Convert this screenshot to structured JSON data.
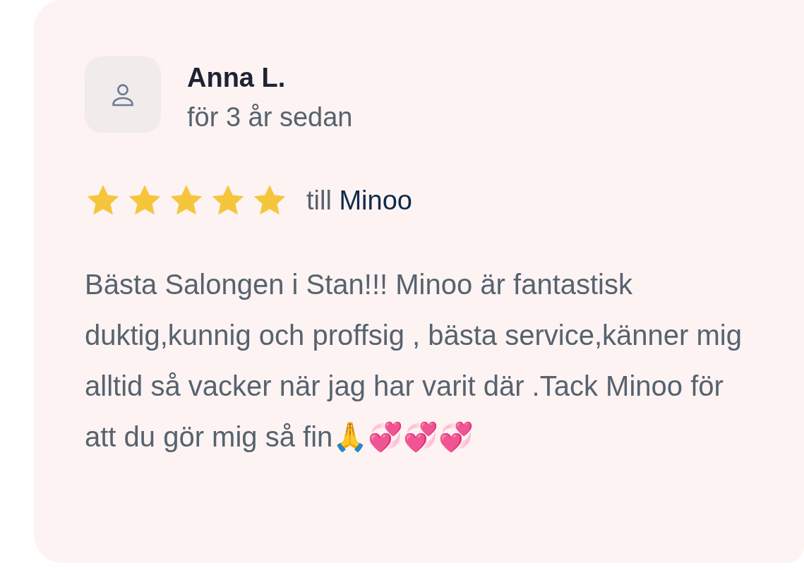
{
  "review": {
    "author": "Anna L.",
    "time": "för 3 år sedan",
    "stars": 5,
    "target_prefix": "till",
    "target_name": "Minoo",
    "text": "Bästa Salongen i Stan!!! Minoo är fantastisk duktig,kunnig och proffsig , bästa service,känner mig alltid så vacker när jag har varit där .Tack Minoo för att du gör mig så fin🙏💞💞💞"
  }
}
